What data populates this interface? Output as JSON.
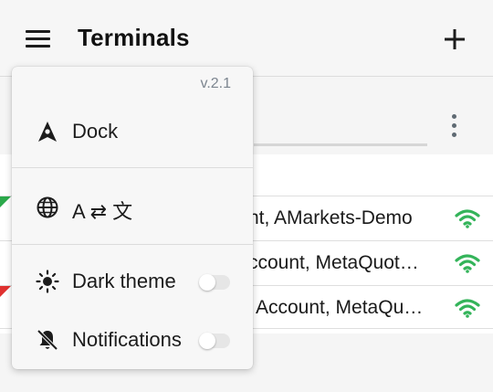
{
  "header": {
    "title": "Terminals",
    "menu_icon": "hamburger-icon",
    "add_icon": "plus-icon"
  },
  "subbar": {
    "more_icon": "more-vertical-icon"
  },
  "terminals": [
    {
      "name": "nt, AMarkets-Demo",
      "signal_icon": "wifi-icon",
      "signal_color": "#34b45a",
      "marker_color": "#2aa84a"
    },
    {
      "name": "ccount, MetaQuot…",
      "signal_icon": "wifi-icon",
      "signal_color": "#34b45a",
      "marker_color": ""
    },
    {
      "name": "Account, MetaQu…",
      "signal_icon": "wifi-icon",
      "signal_color": "#34b45a",
      "marker_color": "#e0312f"
    }
  ],
  "menu": {
    "version": "v.2.1",
    "items": [
      {
        "label": "Dock",
        "icon": "dock-icon"
      },
      {
        "label": "A ⇄ 文",
        "icon": "globe-icon"
      },
      {
        "label": "Dark theme",
        "icon": "sun-icon",
        "toggle_on": false
      },
      {
        "label": "Notifications",
        "icon": "bell-off-icon",
        "toggle_on": false
      }
    ]
  }
}
